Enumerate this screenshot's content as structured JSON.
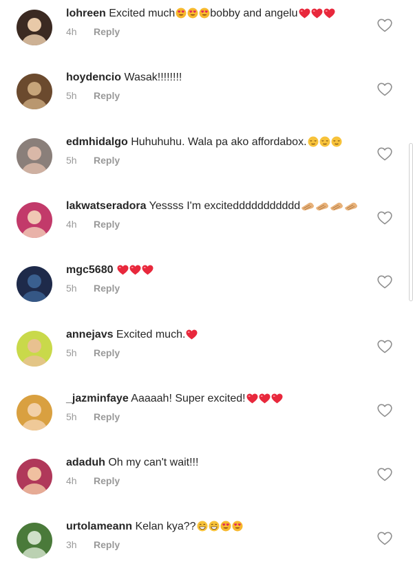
{
  "comments": [
    {
      "username": "lohreen",
      "text": "Excited much",
      "after_emojis_text": "bobby and angelu",
      "emojis": [
        "heart-eyes",
        "heart-eyes",
        "heart-eyes"
      ],
      "trail_emojis": [
        "red-heart",
        "red-heart",
        "red-heart"
      ],
      "time": "4h",
      "reply": "Reply",
      "avatar_colors": [
        "#3b2a22",
        "#e8c9a8"
      ]
    },
    {
      "username": "hoydencio",
      "text": "Wasak!!!!!!!!",
      "emojis": [],
      "trail_emojis": [],
      "time": "5h",
      "reply": "Reply",
      "avatar_colors": [
        "#6b4a2e",
        "#c7a57a"
      ]
    },
    {
      "username": "edmhidalgo",
      "text": "Huhuhuhu. Wala pa ako affordabox.",
      "emojis": [
        "relieved",
        "relieved",
        "relieved"
      ],
      "trail_emojis": [],
      "time": "5h",
      "reply": "Reply",
      "avatar_colors": [
        "#8a7f7a",
        "#d9b8a8"
      ]
    },
    {
      "username": "lakwatseradora",
      "text": "Yessss I'm exciteddddddddddd",
      "emojis": [
        "clap",
        "clap",
        "clap",
        "clap"
      ],
      "trail_emojis": [],
      "time": "4h",
      "reply": "Reply",
      "avatar_colors": [
        "#c23a6a",
        "#f0c8b4"
      ]
    },
    {
      "username": "mgc5680",
      "text": "",
      "emojis": [
        "red-heart",
        "red-heart",
        "red-heart"
      ],
      "trail_emojis": [],
      "time": "5h",
      "reply": "Reply",
      "avatar_colors": [
        "#1e2a4a",
        "#3a5f8f"
      ]
    },
    {
      "username": "annejavs",
      "text": "Excited much.",
      "emojis": [
        "red-heart"
      ],
      "trail_emojis": [],
      "time": "5h",
      "reply": "Reply",
      "avatar_colors": [
        "#c9d94a",
        "#e8c190"
      ]
    },
    {
      "username": "_jazminfaye",
      "text": "Aaaaah! Super excited!",
      "emojis": [
        "red-heart",
        "red-heart",
        "red-heart"
      ],
      "trail_emojis": [],
      "time": "5h",
      "reply": "Reply",
      "avatar_colors": [
        "#d9a040",
        "#f2d0a8"
      ]
    },
    {
      "username": "adaduh",
      "text": "Oh my can't wait!!!",
      "emojis": [],
      "trail_emojis": [],
      "time": "4h",
      "reply": "Reply",
      "avatar_colors": [
        "#b0385a",
        "#f0c0a0"
      ]
    },
    {
      "username": "urtolameann",
      "text": "Kelan kya??",
      "emojis": [
        "grin",
        "grin",
        "heart-eyes",
        "heart-eyes"
      ],
      "trail_emojis": [],
      "time": "3h",
      "reply": "Reply",
      "avatar_colors": [
        "#4a7a3a",
        "#cfe0c8"
      ]
    }
  ]
}
